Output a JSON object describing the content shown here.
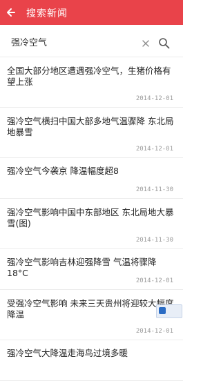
{
  "header": {
    "title": "搜索新闻",
    "back_icon": "arrow-left-icon",
    "background": "#e9434a"
  },
  "search": {
    "query": "强冷空气",
    "clear_icon": "close-icon",
    "search_icon": "search-icon"
  },
  "news": [
    {
      "title": "全国大部分地区遭遇强冷空气，生猪价格有望上涨",
      "date": "2014-12-01"
    },
    {
      "title": "强冷空气横扫中国大部多地气温骤降 东北局地暴雪",
      "date": "2014-12-01"
    },
    {
      "title": "强冷空气今袭京 降温幅度超8",
      "date": "2014-11-30"
    },
    {
      "title": "强冷空气影响中国中东部地区 东北局地大暴雪(图)",
      "date": "2014-11-30"
    },
    {
      "title": "强冷空气影响吉林迎强降雪 气温将骤降18°C",
      "date": "2014-12-01"
    },
    {
      "title": "受强冷空气影响 未来三天贵州将迎较大幅度降温",
      "date": "2014-12-01"
    },
    {
      "title": "强冷空气大降温走海鸟过境多暖",
      "date": ""
    }
  ]
}
